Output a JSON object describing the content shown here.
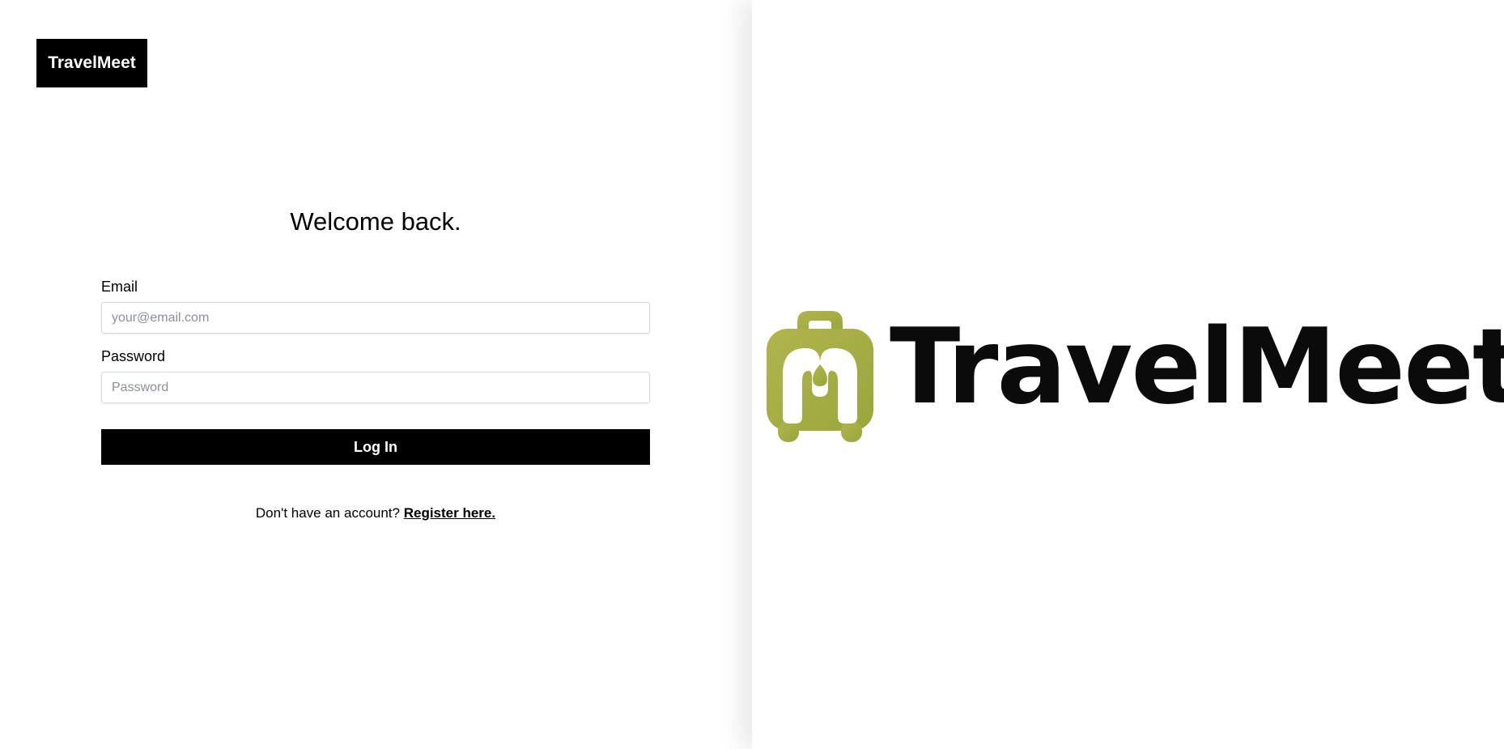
{
  "brand": {
    "name": "TravelMeet"
  },
  "login": {
    "heading": "Welcome back.",
    "email_label": "Email",
    "email_placeholder": "your@email.com",
    "email_value": "",
    "password_label": "Password",
    "password_placeholder": "Password",
    "password_value": "",
    "submit_label": "Log In",
    "register_prompt": "Don't have an account?",
    "register_link": "Register here."
  },
  "hero": {
    "logo_text": "TravelMeet",
    "logo_icon": "suitcase-icon",
    "accent_color": "#a6ad45"
  }
}
